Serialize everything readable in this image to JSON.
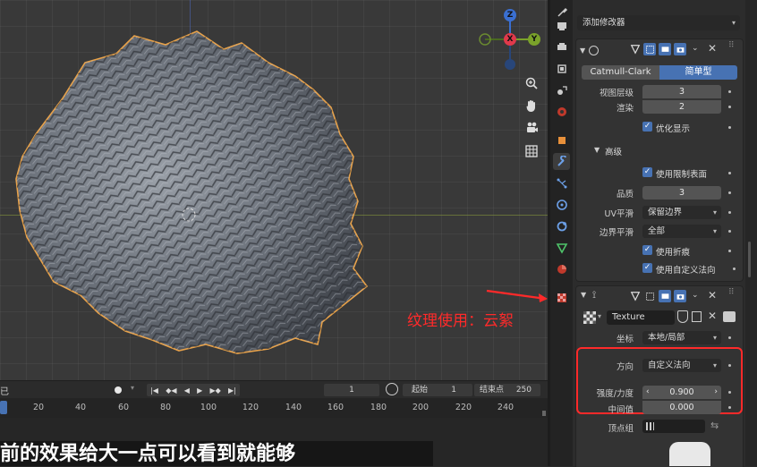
{
  "colors": {
    "accent": "#4772b3",
    "annotation_red": "#ff2a2a",
    "selection_orange": "#e8a24a"
  },
  "viewport": {
    "gizmo": {
      "z": "Z",
      "x": "X",
      "y": "Y"
    },
    "nav_icons": [
      "zoom-icon",
      "hand-pan-icon",
      "camera-icon",
      "grid-icon"
    ],
    "annotation": "纹理使用：云絮"
  },
  "tabs": [
    "tool-icon",
    "render-icon",
    "output-icon",
    "view-layer-icon",
    "scene-icon",
    "world-icon",
    "object-icon",
    "modifier-icon",
    "particles-icon",
    "physics-icon",
    "constraints-icon",
    "data-icon",
    "material-icon",
    "texture-icon"
  ],
  "properties": {
    "add_modifier": "添加修改器",
    "subsurf": {
      "tab_catmull": "Catmull-Clark",
      "tab_simple": "简单型",
      "viewport_levels_label": "视图层级",
      "viewport_levels_value": "3",
      "render_label": "渲染",
      "render_value": "2",
      "optimal_display": "优化显示",
      "advanced": "高级",
      "use_limit_surface": "使用限制表面",
      "quality_label": "品质",
      "quality_value": "3",
      "uv_smooth_label": "UV平滑",
      "uv_smooth_value": "保留边界",
      "boundary_smooth_label": "边界平滑",
      "boundary_smooth_value": "全部",
      "use_creases": "使用折痕",
      "use_custom_normals": "使用自定义法向"
    },
    "displace": {
      "texture_name": "Texture",
      "coords_label": "坐标",
      "coords_value": "本地/局部",
      "direction_label": "方向",
      "direction_value": "自定义法向",
      "strength_label": "强度/力度",
      "strength_value": "0.900",
      "midlevel_label": "中间值",
      "midlevel_value": "0.000",
      "vertex_group_label": "顶点组"
    }
  },
  "timeline": {
    "current_frame": "1",
    "start_label": "起始",
    "start_value": "1",
    "end_label": "结束点",
    "end_value": "250",
    "ticks": [
      "20",
      "40",
      "60",
      "80",
      "100",
      "120",
      "140",
      "160",
      "180",
      "200",
      "220",
      "240"
    ],
    "left_cut": "已"
  },
  "subtitle": "前的效果给大一点可以看到就能够"
}
